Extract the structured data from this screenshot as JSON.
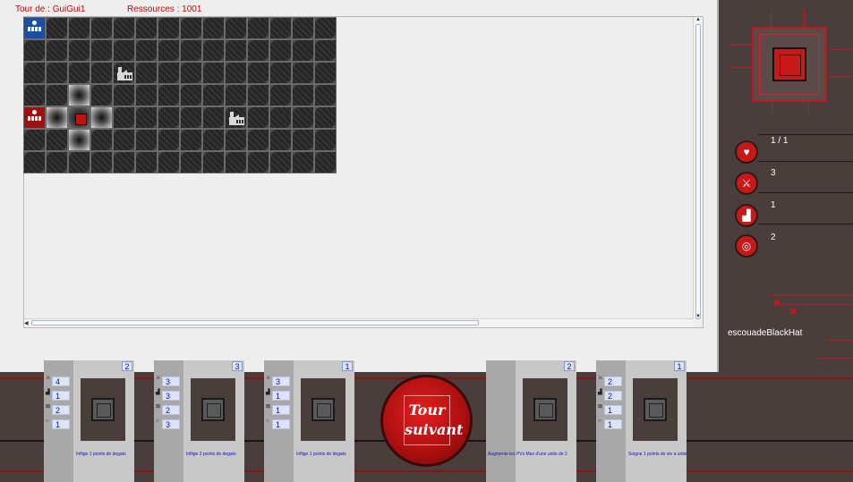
{
  "header": {
    "turn": "Tour de : GuiGui1",
    "resources": "Ressources : 1001"
  },
  "board": {
    "cols": 14,
    "rows": 7,
    "tile": "dark-scale-tile",
    "units": [
      {
        "type": "hq-blue",
        "col": 0,
        "row": 0
      },
      {
        "type": "factory",
        "col": 4,
        "row": 2
      },
      {
        "type": "hq-red",
        "col": 0,
        "row": 4
      },
      {
        "type": "cpu-unit",
        "col": 2,
        "row": 4
      },
      {
        "type": "factory",
        "col": 9,
        "row": 4
      }
    ],
    "highlight": [
      [
        2,
        3
      ],
      [
        1,
        4
      ],
      [
        3,
        4
      ],
      [
        2,
        5
      ]
    ]
  },
  "side": {
    "stats": [
      {
        "icon": "heart-icon",
        "glyph": "♥",
        "value": "1 / 1"
      },
      {
        "icon": "sword-icon",
        "glyph": "⚔",
        "value": "3"
      },
      {
        "icon": "boot-icon",
        "glyph": "▟",
        "value": "1"
      },
      {
        "icon": "target-icon",
        "glyph": "◎",
        "value": "2"
      }
    ],
    "squad_name": "escouadeBlackHat"
  },
  "cards": [
    {
      "cost": "2",
      "desc": "Inflige 1 points de degats",
      "stats": [
        "4",
        "1",
        "2",
        "1"
      ]
    },
    {
      "cost": "3",
      "desc": "Inflige 2 points de degats",
      "stats": [
        "3",
        "3",
        "2",
        "3"
      ]
    },
    {
      "cost": "1",
      "desc": "Inflige 1 points de degats",
      "stats": [
        "3",
        "1",
        "1",
        "1"
      ]
    },
    {
      "cost": "2",
      "desc": "Augmente les PVs Max d'une unite de 2",
      "stats": []
    },
    {
      "cost": "1",
      "desc": "Soigne 1 points de vie a unite",
      "stats": [
        "2",
        "2",
        "1",
        "1"
      ]
    }
  ],
  "next_button": {
    "line1": "Tour",
    "line2": "suivant"
  },
  "colors": {
    "accent_red": "#c81818",
    "panel_bg": "#4a3e3c",
    "text_blue": "#1010c0"
  }
}
